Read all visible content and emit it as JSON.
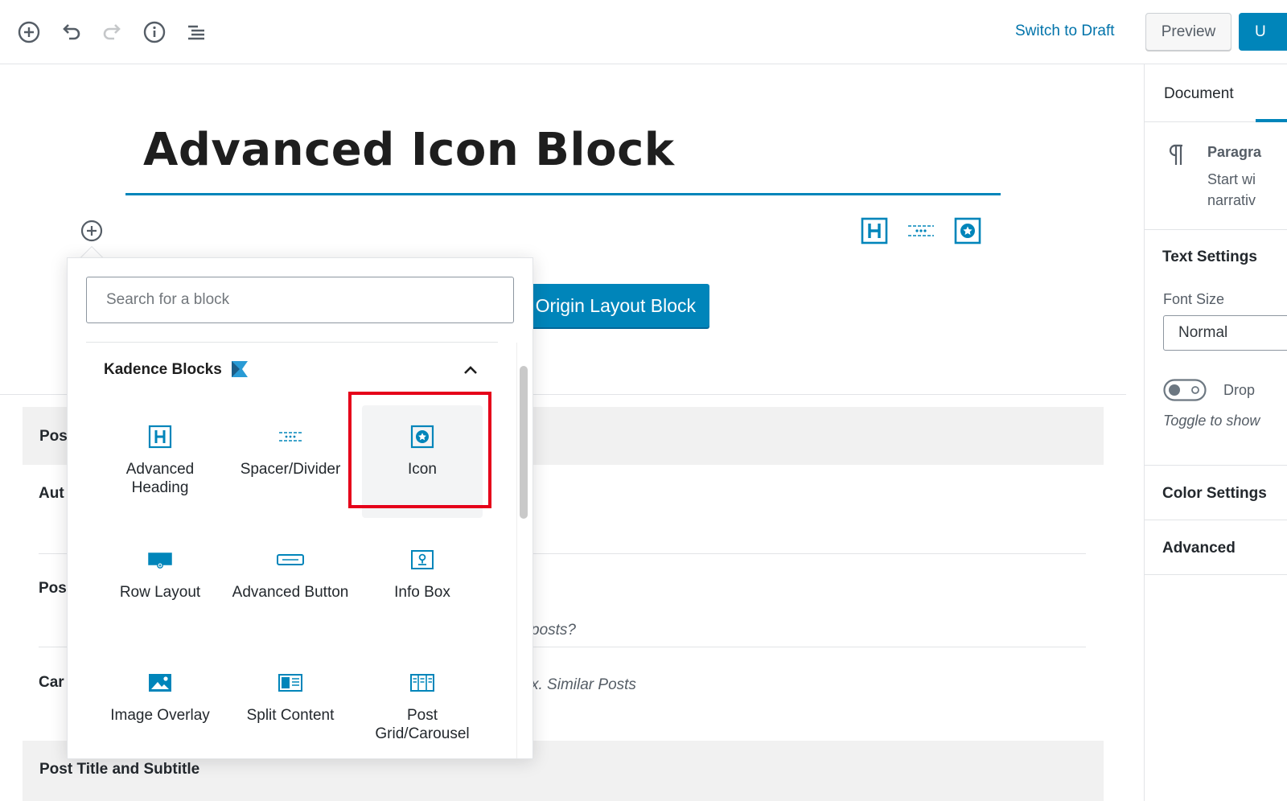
{
  "toolbar": {
    "switch_to_draft": "Switch to Draft",
    "preview": "Preview",
    "update": "U"
  },
  "post": {
    "title": "Advanced Icon Block",
    "origin_layout_button": "Origin Layout Block"
  },
  "inserter": {
    "search_placeholder": "Search for a block",
    "panel_title": "Kadence Blocks",
    "blocks": [
      {
        "label": "Advanced Heading",
        "icon": "heading-block-icon"
      },
      {
        "label": "Spacer/Divider",
        "icon": "spacer-divider-icon"
      },
      {
        "label": "Icon",
        "icon": "icon-block-icon",
        "highlighted": true
      },
      {
        "label": "Row Layout",
        "icon": "row-layout-icon"
      },
      {
        "label": "Advanced Button",
        "icon": "advanced-button-icon"
      },
      {
        "label": "Info Box",
        "icon": "info-box-icon"
      },
      {
        "label": "Image Overlay",
        "icon": "image-overlay-icon"
      },
      {
        "label": "Split Content",
        "icon": "split-content-icon"
      },
      {
        "label": "Post Grid/Carousel",
        "icon": "post-grid-icon"
      }
    ]
  },
  "meta_boxes": {
    "pos_label": "Pos",
    "aut_label": "Aut",
    "pos2_label": "Pos",
    "car_label": "Car",
    "posts_hint": "posts?",
    "similar_hint": "x. Similar Posts",
    "post_title_subtitle": "Post Title and Subtitle"
  },
  "sidebar": {
    "tab_document": "Document",
    "paragraph_title": "Paragra",
    "paragraph_desc_1": "Start wi",
    "paragraph_desc_2": "narrativ",
    "text_settings": "Text Settings",
    "font_size_label": "Font Size",
    "font_size_value": "Normal",
    "drop_cap_label": "Drop",
    "drop_cap_hint": "Toggle to show",
    "color_settings": "Color Settings",
    "advanced": "Advanced"
  },
  "colors": {
    "accent": "#0085ba",
    "link": "#0073aa",
    "highlight": "#e5001a"
  }
}
